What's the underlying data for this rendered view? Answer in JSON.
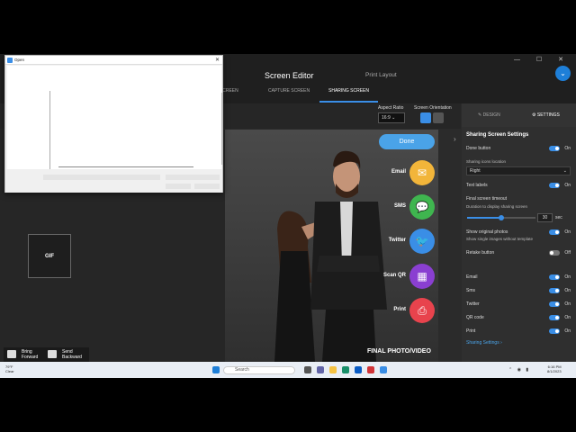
{
  "app": {
    "title": "Screen Editor",
    "print_layout": "Print Layout",
    "window_controls": "— ☐ ✕",
    "avatar_glyph": "⌄"
  },
  "tabs": [
    {
      "label": "ME SCREEN"
    },
    {
      "label": "CAPTURE SCREEN"
    },
    {
      "label": "SHARING SCREEN"
    }
  ],
  "toolbar": {
    "aspect_ratio_label": "Aspect Ratio",
    "aspect_ratio_value": "16:9",
    "orientation_label": "Screen Orientation"
  },
  "canvas": {
    "done_label": "Done",
    "final_label": "FINAL PHOTO/VIDEO",
    "share_items": [
      {
        "label": "Email",
        "color": "#f2b53a",
        "glyph": "✉"
      },
      {
        "label": "SMS",
        "color": "#3fb54f",
        "glyph": "💬"
      },
      {
        "label": "Twitter",
        "color": "#3a8ee6",
        "glyph": "🐦"
      },
      {
        "label": "Scan QR",
        "color": "#8a3fd1",
        "glyph": "▦"
      },
      {
        "label": "Print",
        "color": "#e8434d",
        "glyph": "⎙"
      }
    ]
  },
  "left": {
    "gif_label": "GIF",
    "bring_forward": "Bring Forward",
    "send_backward": "Send Backward"
  },
  "settings": {
    "design_tab": "✎ DESIGN",
    "settings_tab": "⚙ SETTINGS",
    "title": "Sharing Screen Settings",
    "done_button": "Done button",
    "done_button_state": "On",
    "icons_location_label": "Sharing icons location",
    "icons_location_value": "Right",
    "text_labels": "Text labels",
    "text_labels_state": "On",
    "timeout_title": "Final screen timeout",
    "timeout_sub": "Duration to display sharing screen",
    "timeout_value": "30",
    "timeout_unit": "sec",
    "show_original": "Show original photos",
    "show_original_state": "On",
    "show_original_sub": "Show single images without template",
    "retake": "Retake button",
    "retake_state": "Off",
    "channels": [
      {
        "label": "Email",
        "state": "On"
      },
      {
        "label": "Sms",
        "state": "On"
      },
      {
        "label": "Twitter",
        "state": "On"
      },
      {
        "label": "QR code",
        "state": "On"
      },
      {
        "label": "Print",
        "state": "On"
      }
    ],
    "link": "Sharing Settings ›",
    "slider_fraction": 0.5
  },
  "dialog": {
    "title": "Open",
    "close": "✕"
  },
  "taskbar": {
    "weather_temp": "79°F",
    "weather_desc": "Clear",
    "search_placeholder": "Search",
    "time": "6:16 PM",
    "date": "8/1/2023"
  }
}
